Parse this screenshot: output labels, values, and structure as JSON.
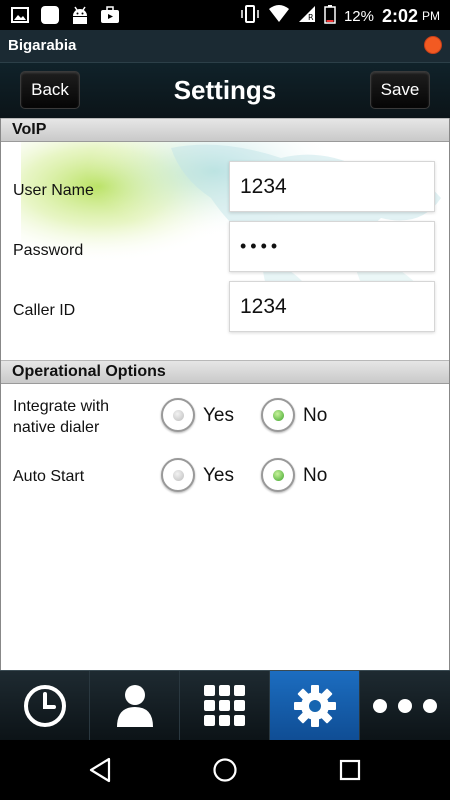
{
  "status_bar": {
    "battery_percent": "12%",
    "time": "2:02",
    "ampm": "PM"
  },
  "app": {
    "name": "Bigarabia"
  },
  "header": {
    "title": "Settings",
    "back_label": "Back",
    "save_label": "Save"
  },
  "voip": {
    "section_title": "VoIP",
    "username_label": "User Name",
    "username_value": "1234",
    "password_label": "Password",
    "password_value": "••••",
    "callerid_label": "Caller ID",
    "callerid_value": "1234"
  },
  "options": {
    "section_title": "Operational Options",
    "integrate_label_line1": "Integrate with",
    "integrate_label_line2": "native dialer",
    "integrate_yes": "Yes",
    "integrate_no": "No",
    "integrate_selected": "No",
    "autostart_label": "Auto Start",
    "autostart_yes": "Yes",
    "autostart_no": "No",
    "autostart_selected": "No"
  },
  "tabs": [
    {
      "icon": "clock-icon"
    },
    {
      "icon": "contact-icon"
    },
    {
      "icon": "keypad-icon"
    },
    {
      "icon": "gear-icon",
      "active": true
    },
    {
      "icon": "more-icon"
    }
  ],
  "colors": {
    "accent": "#1c6dc0",
    "app_dot": "#f25a22",
    "radio_selected": "#3fa52d"
  }
}
